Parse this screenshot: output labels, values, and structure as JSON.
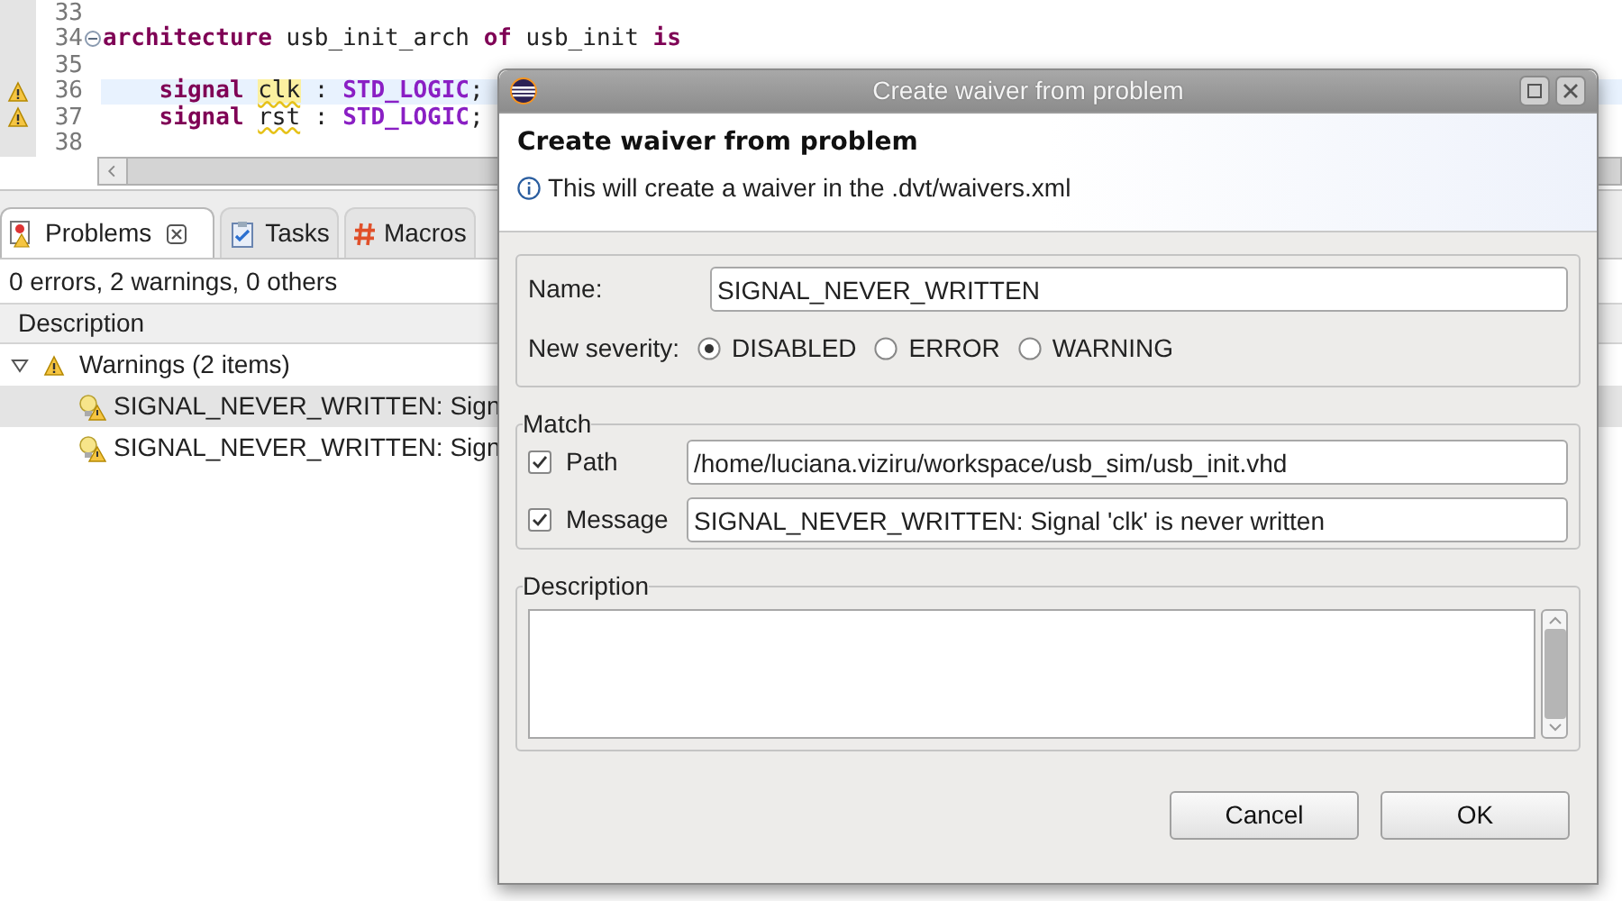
{
  "editor": {
    "lines": [
      {
        "number": "33",
        "warning": false,
        "foldable": false,
        "current": false
      },
      {
        "number": "34",
        "warning": false,
        "foldable": true,
        "current": false,
        "tokens": [
          {
            "kind": "keyword",
            "text": "architecture"
          },
          {
            "kind": "plain",
            "text": " usb_init_arch "
          },
          {
            "kind": "keyword",
            "text": "of"
          },
          {
            "kind": "plain",
            "text": " usb_init "
          },
          {
            "kind": "keyword",
            "text": "is"
          }
        ]
      },
      {
        "number": "35",
        "warning": false,
        "foldable": false,
        "current": false
      },
      {
        "number": "36",
        "warning": true,
        "foldable": false,
        "current": true,
        "tokens": [
          {
            "kind": "keyword",
            "text": "    signal "
          },
          {
            "kind": "ident",
            "text": "clk",
            "squiggle": true,
            "highlight": true
          },
          {
            "kind": "plain",
            "text": " : "
          },
          {
            "kind": "type",
            "text": "STD_LOGIC"
          },
          {
            "kind": "plain",
            "text": ";"
          }
        ]
      },
      {
        "number": "37",
        "warning": true,
        "foldable": false,
        "current": false,
        "tokens": [
          {
            "kind": "keyword",
            "text": "    signal "
          },
          {
            "kind": "ident",
            "text": "rst",
            "squiggle": true,
            "highlight": false
          },
          {
            "kind": "plain",
            "text": " : "
          },
          {
            "kind": "type",
            "text": "STD_LOGIC"
          },
          {
            "kind": "plain",
            "text": ";"
          }
        ]
      },
      {
        "number": "38",
        "warning": false,
        "foldable": false,
        "current": false
      }
    ]
  },
  "problems_view": {
    "tabs": [
      {
        "kind": "problems",
        "label": "Problems",
        "selected": true
      },
      {
        "kind": "tasks",
        "label": "Tasks",
        "selected": false
      },
      {
        "kind": "macros",
        "label": "Macros",
        "selected": false
      }
    ],
    "summary": "0 errors, 2 warnings, 0 others",
    "columns": [
      "Description"
    ],
    "tree": [
      {
        "label": "Warnings (2 items)",
        "expanded": true,
        "selected": false,
        "children": [
          {
            "label": "SIGNAL_NEVER_WRITTEN: Sign",
            "selected": true
          },
          {
            "label": "SIGNAL_NEVER_WRITTEN: Sign",
            "selected": false
          }
        ]
      }
    ]
  },
  "dialog": {
    "title": "Create waiver from problem",
    "header": {
      "title": "Create waiver from problem",
      "message": "This will create a waiver in the .dvt/waivers.xml"
    },
    "name": {
      "label": "Name:",
      "value": "SIGNAL_NEVER_WRITTEN"
    },
    "severity": {
      "label": "New severity:",
      "options": [
        {
          "label": "DISABLED",
          "selected": true
        },
        {
          "label": "ERROR",
          "selected": false
        },
        {
          "label": "WARNING",
          "selected": false
        }
      ]
    },
    "match": {
      "title": "Match",
      "rows": [
        {
          "label": "Path",
          "checked": true,
          "value": "/home/luciana.viziru/workspace/usb_sim/usb_init.vhd"
        },
        {
          "label": "Message",
          "checked": true,
          "value": "SIGNAL_NEVER_WRITTEN: Signal 'clk' is never written"
        }
      ]
    },
    "description": {
      "title": "Description"
    },
    "buttons": [
      "Cancel",
      "OK"
    ]
  }
}
